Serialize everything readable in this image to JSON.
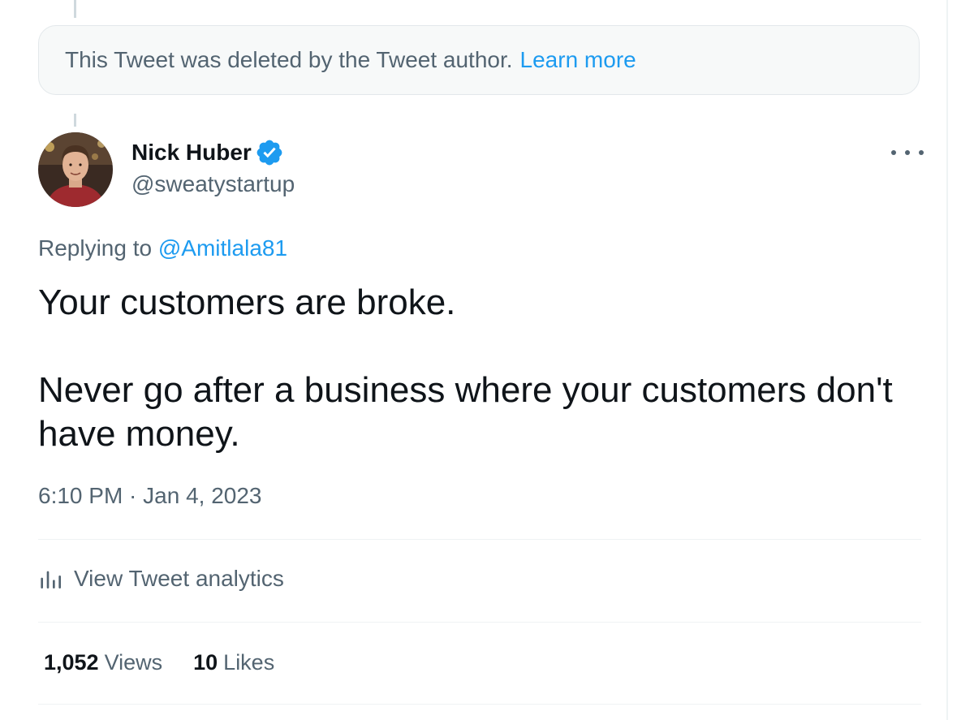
{
  "deleted_notice": {
    "text": "This Tweet was deleted by the Tweet author.",
    "link_label": "Learn more"
  },
  "author": {
    "name": "Nick Huber",
    "handle": "@sweatystartup",
    "verified": true
  },
  "reply": {
    "prefix": "Replying to",
    "mention": "@Amitlala81"
  },
  "tweet": {
    "line1": "Your customers are broke.",
    "line2": "Never go after a business where your customers don't have money."
  },
  "timestamp": "6:10 PM · Jan 4, 2023",
  "analytics_label": "View Tweet analytics",
  "stats": {
    "views_count": "1,052",
    "views_label": "Views",
    "likes_count": "10",
    "likes_label": "Likes"
  },
  "colors": {
    "accent": "#1d9bf0",
    "text_primary": "#0f1419",
    "text_secondary": "#536471",
    "border": "#eff3f4"
  },
  "icons": {
    "verified": "verified-badge-icon",
    "more": "more-dots-icon",
    "analytics": "bar-chart-icon"
  }
}
